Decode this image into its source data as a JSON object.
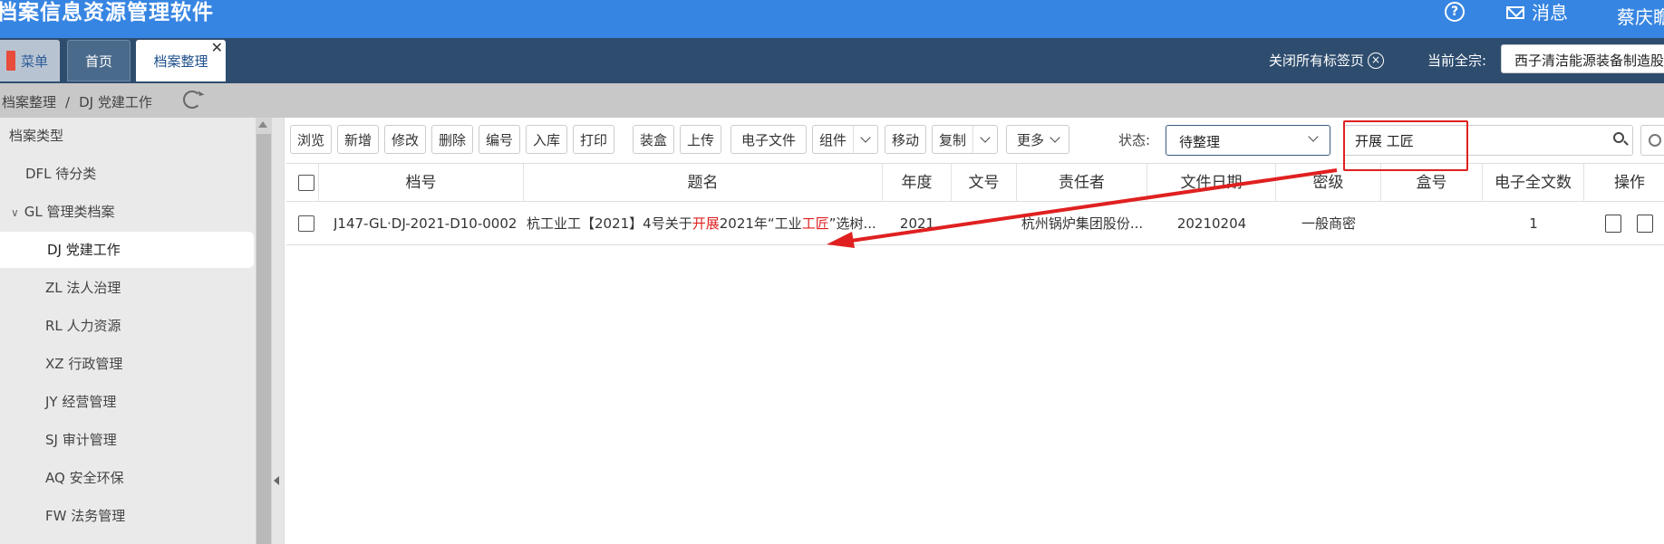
{
  "app": {
    "title": "档案信息资源管理软件",
    "messages_label": "消息",
    "user_name": "蔡庆瞻"
  },
  "tabs": {
    "menu_label": "菜单",
    "home_label": "首页",
    "active_label": "档案整理",
    "close_glyph": "✕",
    "close_all_label": "关闭所有标签页",
    "current_fonds_label": "当前全宗:",
    "current_fonds_value": "西子清洁能源装备制造股份有限公司"
  },
  "breadcrumb": {
    "root": "档案整理",
    "sep": "/",
    "current": "DJ 党建工作"
  },
  "sidebar": {
    "header": "档案类型",
    "items": [
      {
        "label": "DFL 待分类"
      },
      {
        "label": "GL 管理类档案",
        "expander": "∨"
      },
      {
        "label": "DJ 党建工作"
      },
      {
        "label": "ZL 法人治理"
      },
      {
        "label": "RL 人力资源"
      },
      {
        "label": "XZ 行政管理"
      },
      {
        "label": "JY 经营管理"
      },
      {
        "label": "SJ 审计管理"
      },
      {
        "label": "AQ 安全环保"
      },
      {
        "label": "FW 法务管理"
      }
    ]
  },
  "toolbar": {
    "browse": "浏览",
    "add": "新增",
    "edit": "修改",
    "delete": "删除",
    "number": "编号",
    "stock_in": "入库",
    "print": "打印",
    "box": "装盒",
    "upload": "上传",
    "e_file": "电子文件",
    "group": "组件",
    "move": "移动",
    "copy": "复制",
    "more": "更多",
    "status_label": "状态:",
    "status_value": "待整理",
    "search_value": "开展 工匠"
  },
  "table": {
    "headers": {
      "doc_no": "档号",
      "title": "题名",
      "year": "年度",
      "file_no": "文号",
      "owner": "责任者",
      "date": "文件日期",
      "secret": "密级",
      "box_no": "盒号",
      "e_count": "电子全文数",
      "ops": "操作"
    },
    "rows": [
      {
        "doc_no": "J147-GL·DJ-2021-D10-0002",
        "title_parts": [
          "杭工业工【2021】4号关于",
          "开展",
          "2021年“工业",
          "工匠",
          "”选树..."
        ],
        "year": "2021",
        "file_no": "",
        "owner": "杭州锅炉集团股份...",
        "date": "20210204",
        "secret": "一般商密",
        "box_no": "",
        "e_count": "1"
      }
    ]
  },
  "colors": {
    "topbar": "#3785e2",
    "tabbar": "#2e4d6e",
    "highlight": "#e02020",
    "annotation": "#e02020"
  }
}
